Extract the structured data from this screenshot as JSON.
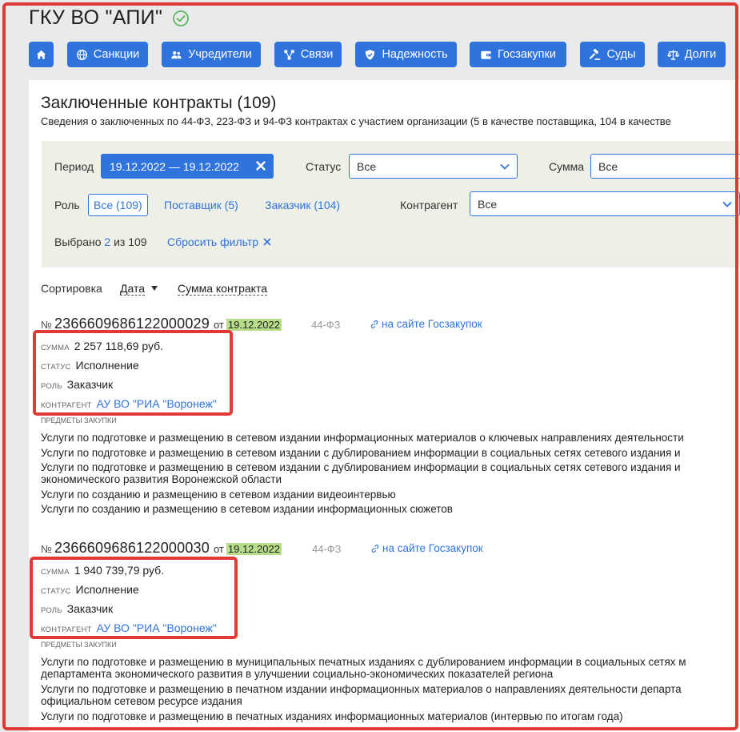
{
  "header": {
    "org_name": "ГКУ ВО \"АПИ\""
  },
  "nav": {
    "items": [
      {
        "label": "",
        "icon": "home-icon"
      },
      {
        "label": "Санкции",
        "icon": "globe-icon"
      },
      {
        "label": "Учредители",
        "icon": "users-icon"
      },
      {
        "label": "Связи",
        "icon": "graph-icon"
      },
      {
        "label": "Надежность",
        "icon": "shield-icon"
      },
      {
        "label": "Госзакупки",
        "icon": "wallet-icon"
      },
      {
        "label": "Суды",
        "icon": "gavel-icon"
      },
      {
        "label": "Долги",
        "icon": "scales-icon"
      }
    ]
  },
  "section": {
    "title": "Заключенные контракты (109)",
    "subtitle": "Сведения о заключенных по 44-ФЗ, 223-ФЗ и 94-ФЗ контрактах с участием организации (5 в качестве поставщика, 104 в качестве"
  },
  "filters": {
    "period_label": "Период",
    "period_value": "19.12.2022 — 19.12.2022",
    "status_label": "Статус",
    "status_value": "Все",
    "sum_label": "Сумма",
    "sum_value": "Все",
    "role_label": "Роль",
    "role_all": "Все (109)",
    "role_supplier": "Поставщик (5)",
    "role_customer": "Заказчик (104)",
    "counterparty_label": "Контрагент",
    "counterparty_value": "Все",
    "selected_prefix": "Выбрано",
    "selected_count": "2",
    "selected_suffix": "из 109",
    "reset_label": "Сбросить фильтр"
  },
  "sort": {
    "label": "Сортировка",
    "date": "Дата",
    "sum": "Сумма контракта"
  },
  "contracts": [
    {
      "no_sign": "№",
      "number": "2366609686122000029",
      "from": "от",
      "date": "19.12.2022",
      "law": "44-ФЗ",
      "site_link": "на сайте Госзакупок",
      "sum_label": "сумма",
      "sum": "2 257 118,69 руб.",
      "status_label": "статус",
      "status": "Исполнение",
      "role_label": "роль",
      "role": "Заказчик",
      "counterparty_label": "контрагент",
      "counterparty": "АУ ВО \"РИА \"Воронеж\"",
      "subjects_label": "предметы закупки",
      "subjects": [
        "Услуги по подготовке и размещению в сетевом издании информационных материалов о ключевых направлениях деятельности",
        "Услуги по подготовке и размещению в сетевом издании с дублированием информации в социальных сетях сетевого издания и",
        "Услуги по подготовке и размещению в сетевом издании с дублированием информации в социальных сетях сетевого издания и",
        "экономического развития Воронежской области",
        "Услуги по созданию и размещению в сетевом издании видеоинтервью",
        "Услуги по созданию и размещению в сетевом издании информационных сюжетов"
      ]
    },
    {
      "no_sign": "№",
      "number": "2366609686122000030",
      "from": "от",
      "date": "19.12.2022",
      "law": "44-ФЗ",
      "site_link": "на сайте Госзакупок",
      "sum_label": "сумма",
      "sum": "1 940 739,79 руб.",
      "status_label": "статус",
      "status": "Исполнение",
      "role_label": "роль",
      "role": "Заказчик",
      "counterparty_label": "контрагент",
      "counterparty": "АУ ВО \"РИА \"Воронеж\"",
      "subjects_label": "предметы закупки",
      "subjects": [
        "Услуги по подготовке и размещению в муниципальных печатных изданиях с дублированием информации в социальных сетях м",
        "департамента экономического развития в улучшении социально-экономических показателей региона",
        "Услуги по подготовке и размещению в печатном издании информационных материалов о направлениях деятельности департа",
        "официальном сетевом ресурсе издания",
        "Услуги по подготовке и размещению в печатных изданиях информационных материалов (интервью по итогам года)"
      ]
    }
  ],
  "colors": {
    "accent": "#2f74dc",
    "highlight_border": "#e03a36",
    "date_badge": "#b7dd8b",
    "filter_bg": "#eeefe6"
  }
}
